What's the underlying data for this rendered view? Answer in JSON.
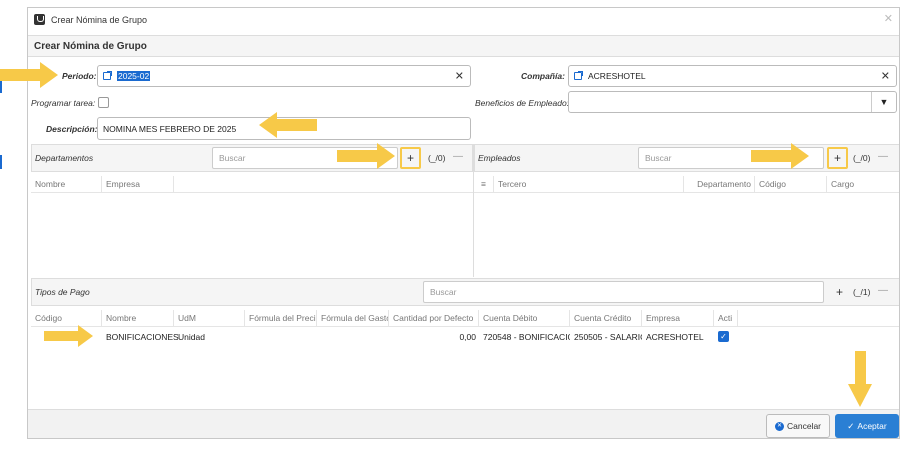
{
  "window": {
    "title": "Crear Nómina de Grupo"
  },
  "form": {
    "header": "Crear Nómina de Grupo",
    "periodo_label": "Periodo:",
    "periodo_value": "2025-02",
    "compania_label": "Compañía:",
    "compania_value": "ACRESHOTEL",
    "programar_label": "Programar tarea:",
    "beneficios_label": "Beneficios de Empleado:",
    "descripcion_label": "Descripción:",
    "descripcion_value": "NOMINA MES FEBRERO DE 2025"
  },
  "departamentos": {
    "title": "Departamentos",
    "search_placeholder": "Buscar",
    "count": "(_/0)",
    "columns": [
      "Nombre",
      "Empresa"
    ]
  },
  "empleados": {
    "title": "Empleados",
    "search_placeholder": "Buscar",
    "count": "(_/0)",
    "columns": [
      "Tercero",
      "Departamento",
      "Código",
      "Cargo"
    ]
  },
  "tipos_pago": {
    "title": "Tipos de Pago",
    "search_placeholder": "Buscar",
    "count": "(_/1)",
    "columns": [
      "Código",
      "Nombre",
      "UdM",
      "Fórmula del Preci",
      "Fórmula del Gastc",
      "Cantidad por Defecto",
      "Cuenta Débito",
      "Cuenta Crédito",
      "Empresa",
      "Acti"
    ],
    "rows": [
      {
        "codigo": "",
        "nombre": "BONIFICACIONES",
        "udm": "Unidad",
        "formula_precio": "",
        "formula_gasto": "",
        "cantidad": "0,00",
        "cuenta_debito": "720548 - BONIFICACIOI",
        "cuenta_credito": "250505 - SALARIO",
        "empresa": "ACRESHOTEL",
        "activo": true
      }
    ]
  },
  "buttons": {
    "cancel": "Cancelar",
    "accept": "Aceptar"
  },
  "colors": {
    "accent": "#1a6ad0",
    "highlight": "#f7c948",
    "accept_bg": "#2a7fd4"
  }
}
